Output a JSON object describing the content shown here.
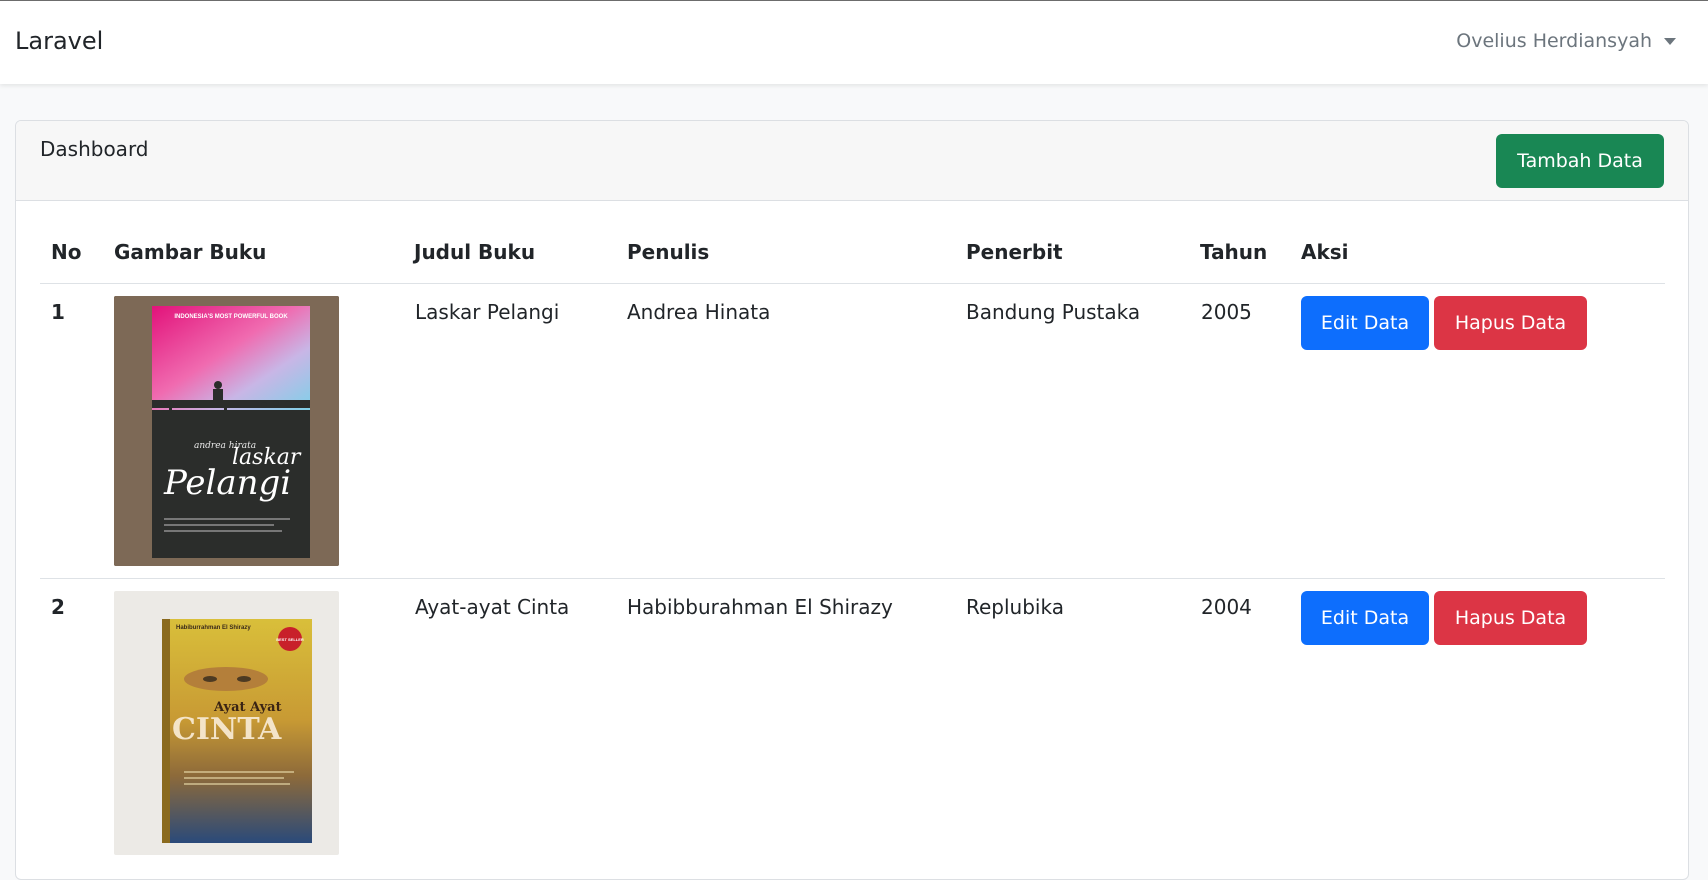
{
  "navbar": {
    "brand": "Laravel",
    "user_name": "Ovelius Herdiansyah",
    "user_menu_icon": "chevron-down-icon"
  },
  "card": {
    "title": "Dashboard",
    "add_button": "Tambah Data"
  },
  "table": {
    "headers": [
      "No",
      "Gambar Buku",
      "Judul Buku",
      "Penulis",
      "Penerbit",
      "Tahun",
      "Aksi"
    ],
    "rows": [
      {
        "no": "1",
        "judul": "Laskar Pelangi",
        "penulis": "Andrea Hinata",
        "penerbit": "Bandung Pustaka",
        "tahun": "2005",
        "cover": {
          "top_text": "INDONESIA'S MOST POWERFUL BOOK",
          "author_text": "andrea hirata",
          "title_line1": "laskar",
          "title_line2": "Pelangi"
        },
        "edit_label": "Edit Data",
        "delete_label": "Hapus Data"
      },
      {
        "no": "2",
        "judul": "Ayat-ayat Cinta",
        "penulis": "Habibburahman El Shirazy",
        "penerbit": "Replubika",
        "tahun": "2004",
        "cover": {
          "author_text": "Habiburrahman El Shirazy",
          "badge_text": "BEST SELLER",
          "title_line1": "Ayat Ayat",
          "title_line2": "CINTA"
        },
        "edit_label": "Edit Data",
        "delete_label": "Hapus Data"
      }
    ]
  },
  "colors": {
    "primary": "#0d6efd",
    "success": "#198754",
    "danger": "#dc3545",
    "muted": "#6c757d"
  }
}
